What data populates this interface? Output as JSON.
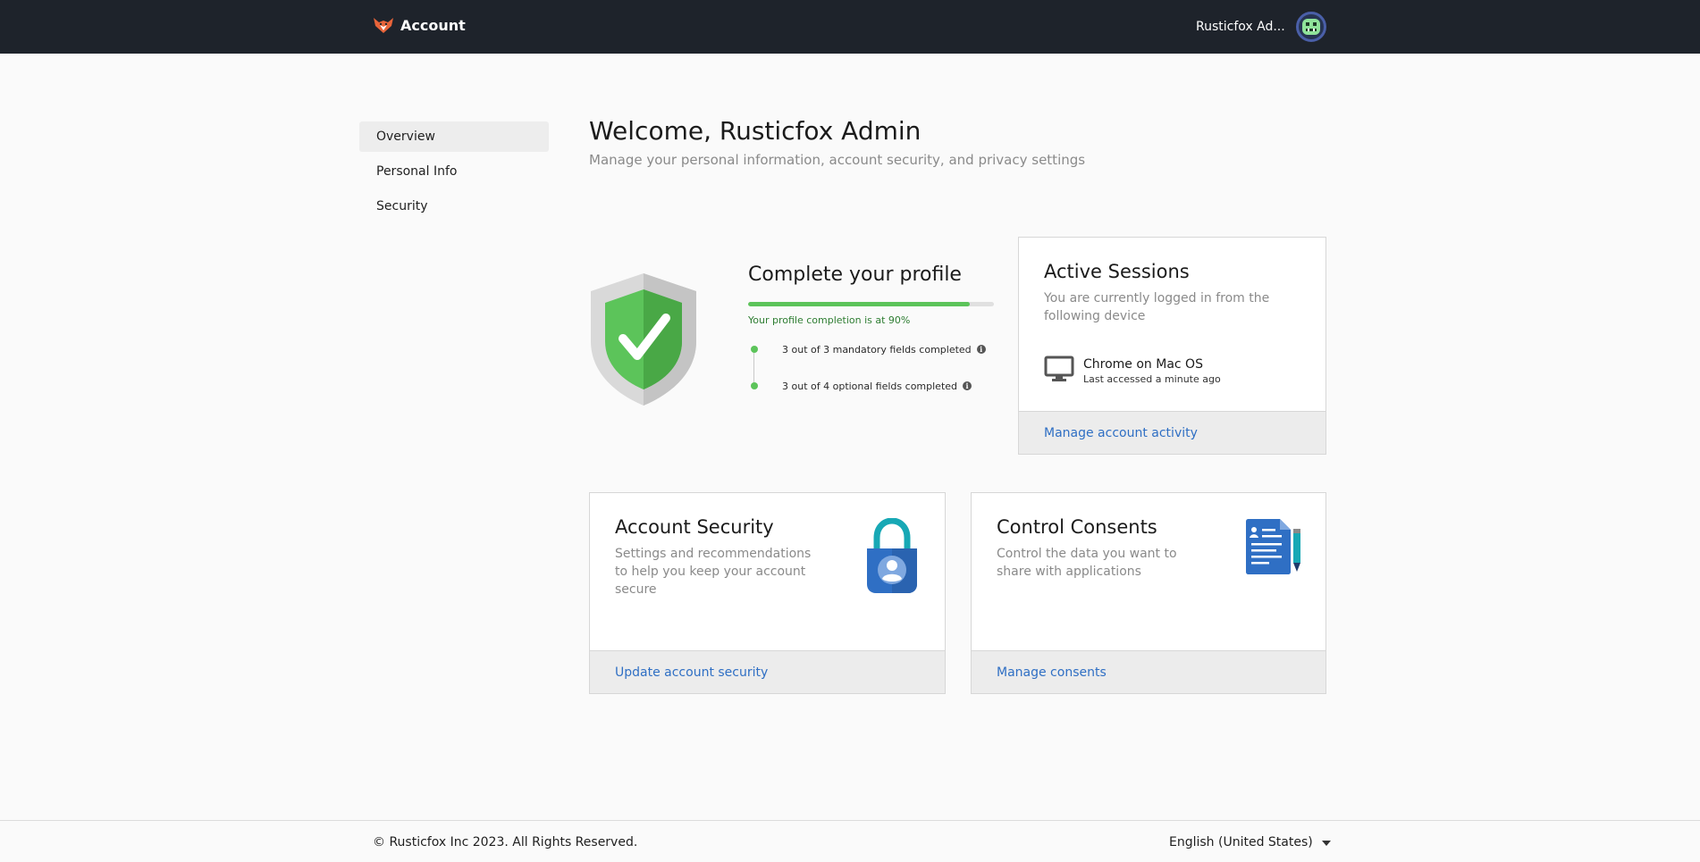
{
  "header": {
    "app_title": "Account",
    "user_name": "Rusticfox Ad..."
  },
  "sidebar": {
    "items": [
      {
        "label": "Overview",
        "active": true
      },
      {
        "label": "Personal Info",
        "active": false
      },
      {
        "label": "Security",
        "active": false
      }
    ]
  },
  "main": {
    "title": "Welcome, Rusticfox Admin",
    "subtitle": "Manage your personal information, account security, and privacy settings"
  },
  "profile": {
    "title": "Complete your profile",
    "completion_percent": 90,
    "completion_text": "Your profile completion is at 90%",
    "checklist": [
      {
        "label": "3 out of 3 mandatory fields completed"
      },
      {
        "label": "3 out of 4 optional fields completed"
      }
    ]
  },
  "sessions": {
    "title": "Active Sessions",
    "description": "You are currently logged in from the following device",
    "device_name": "Chrome on Mac OS",
    "device_last_access": "Last accessed a minute ago",
    "link": "Manage account activity"
  },
  "security_card": {
    "title": "Account Security",
    "description": "Settings and recommendations to help you keep your account secure",
    "link": "Update account security"
  },
  "consents_card": {
    "title": "Control Consents",
    "description": "Control the data you want to share with applications",
    "link": "Manage consents"
  },
  "footer": {
    "copyright": "© Rusticfox Inc 2023. All Rights Reserved.",
    "language": "English (United States)"
  },
  "colors": {
    "header_bg": "#1e232b",
    "accent_green": "#5cc45a",
    "link_blue": "#2f6fc4"
  },
  "icons": {
    "brand": "fox-logo-icon",
    "shield": "shield-check-icon",
    "monitor": "monitor-icon",
    "lock": "lock-user-icon",
    "document": "document-pen-icon",
    "caret": "caret-down-icon",
    "info": "info-icon"
  }
}
